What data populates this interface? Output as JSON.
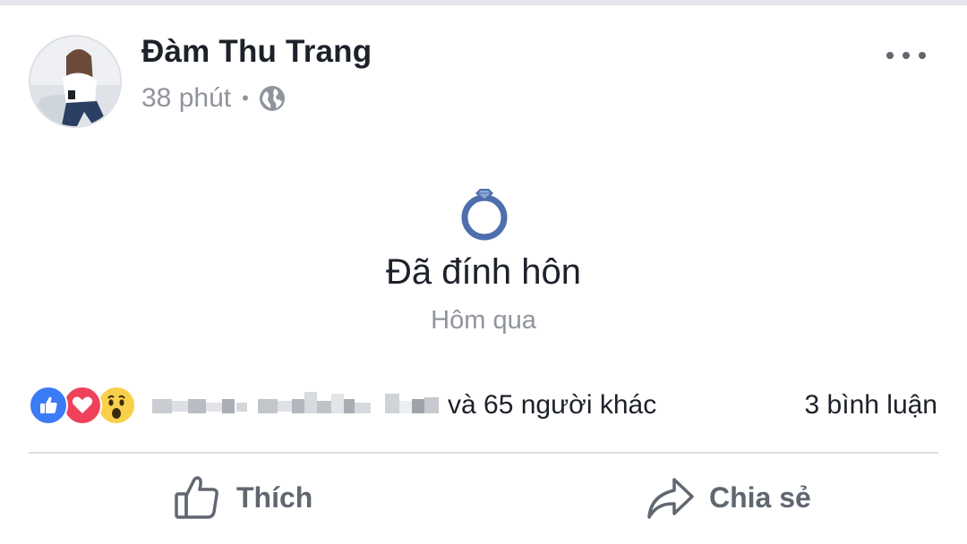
{
  "post": {
    "author_name": "Đàm Thu Trang",
    "time": "38 phút",
    "privacy_icon": "globe-icon",
    "more_icon": "ellipsis-icon"
  },
  "life_event": {
    "icon": "engagement-ring-icon",
    "title": "Đã đính hôn",
    "date": "Hôm qua"
  },
  "reactions": {
    "types": [
      "like",
      "love",
      "wow"
    ],
    "others_text": "và 65 người khác",
    "comments_text": "3 bình luận"
  },
  "actions": {
    "like_label": "Thích",
    "share_label": "Chia sẻ"
  },
  "colors": {
    "like_blue": "#3b7bf6",
    "love_red": "#f0415a",
    "wow_yellow": "#f8d04a",
    "ring_blue": "#4e6eae",
    "text_primary": "#1d2129",
    "text_secondary": "#90949c"
  }
}
